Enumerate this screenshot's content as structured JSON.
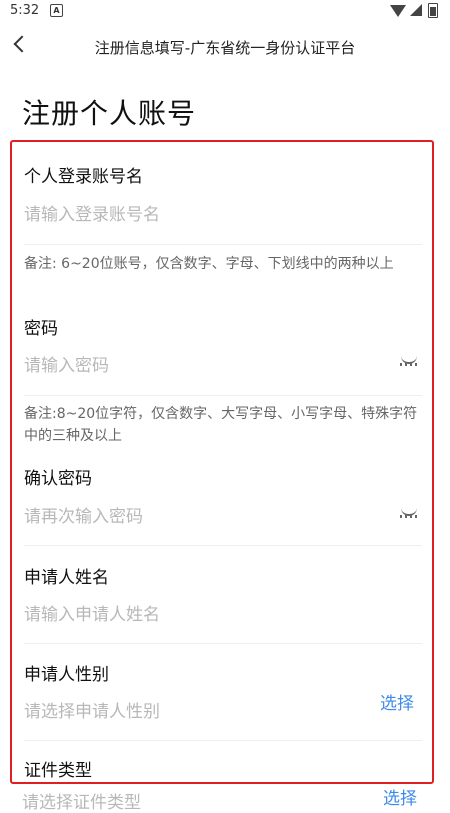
{
  "status_bar": {
    "time": "5:32",
    "notification_glyph": "A"
  },
  "header": {
    "title": "注册信息填写-广东省统一身份认证平台"
  },
  "page_title": "注册个人账号",
  "form": {
    "username": {
      "label": "个人登录账号名",
      "placeholder": "请输入登录账号名"
    },
    "username_note": "备注: 6~20位账号，仅含数字、字母、下划线中的两种以上",
    "password": {
      "label": "密码",
      "placeholder": "请输入密码"
    },
    "password_note": "备注:8~20位字符，仅含数字、大写字母、小写字母、特殊字符中的三种及以上",
    "confirm_password": {
      "label": "确认密码",
      "placeholder": "请再次输入密码"
    },
    "applicant_name": {
      "label": "申请人姓名",
      "placeholder": "请输入申请人姓名"
    },
    "applicant_gender": {
      "label": "申请人性别",
      "placeholder": "请选择申请人性别",
      "action": "选择"
    },
    "id_type": {
      "label": "证件类型",
      "placeholder": "请选择证件类型",
      "action": "选择"
    }
  },
  "colors": {
    "highlight_border": "#e02020",
    "link": "#3d8be8",
    "placeholder": "#b8b8b8"
  },
  "icons": {
    "back": "back-arrow-icon",
    "eye": "eye-closed-icon",
    "wifi": "wifi-icon",
    "signal": "signal-icon",
    "battery": "battery-icon"
  }
}
